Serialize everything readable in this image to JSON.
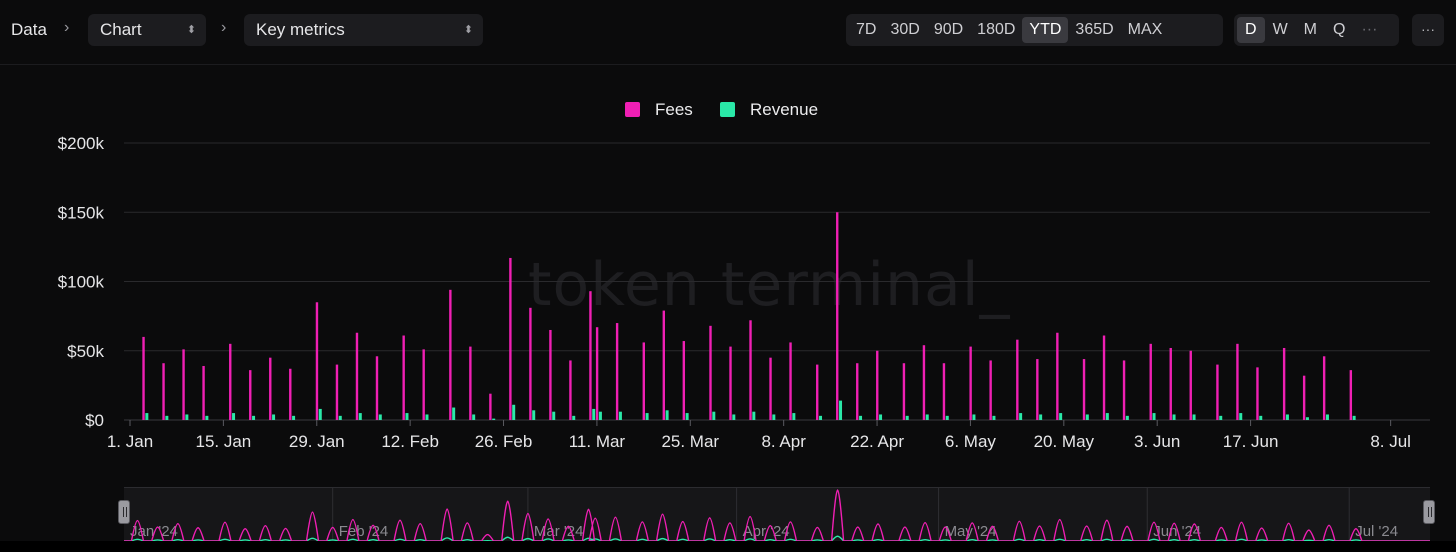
{
  "breadcrumb": {
    "root": "Data",
    "select1": "Chart",
    "select2": "Key metrics"
  },
  "ranges": [
    "7D",
    "30D",
    "90D",
    "180D",
    "YTD",
    "365D",
    "MAX"
  ],
  "active_range": "YTD",
  "granularity": [
    "D",
    "W",
    "M",
    "Q",
    "···"
  ],
  "active_granularity": "D",
  "more": "···",
  "watermark": "token terminal_",
  "colors": {
    "fees": "#f01fb4",
    "revenue": "#2ae8a8",
    "grid": "#2a2a2d",
    "background": "#0b0b0c"
  },
  "chart_data": {
    "type": "bar",
    "title": "",
    "legend_position": "top-center",
    "grid": true,
    "ylim": [
      0,
      200000
    ],
    "y_ticks": [
      0,
      50000,
      100000,
      150000,
      200000
    ],
    "y_tick_labels": [
      "$0",
      "$50k",
      "$100k",
      "$150k",
      "$200k"
    ],
    "x_tick_labels": [
      "1. Jan",
      "15. Jan",
      "29. Jan",
      "12. Feb",
      "26. Feb",
      "11. Mar",
      "25. Mar",
      "8. Apr",
      "22. Apr",
      "6. May",
      "20. May",
      "3. Jun",
      "17. Jun",
      "8. Jul"
    ],
    "x_tick_dates": [
      "2024-01-01",
      "2024-01-15",
      "2024-01-29",
      "2024-02-12",
      "2024-02-26",
      "2024-03-11",
      "2024-03-25",
      "2024-04-08",
      "2024-04-22",
      "2024-05-06",
      "2024-05-20",
      "2024-06-03",
      "2024-06-17",
      "2024-07-08"
    ],
    "x_range": [
      "2024-01-01",
      "2024-07-13"
    ],
    "dates": [
      "2024-01-03",
      "2024-01-06",
      "2024-01-09",
      "2024-01-12",
      "2024-01-16",
      "2024-01-19",
      "2024-01-22",
      "2024-01-25",
      "2024-01-29",
      "2024-02-01",
      "2024-02-04",
      "2024-02-07",
      "2024-02-11",
      "2024-02-14",
      "2024-02-18",
      "2024-02-21",
      "2024-02-24",
      "2024-02-27",
      "2024-03-01",
      "2024-03-04",
      "2024-03-07",
      "2024-03-10",
      "2024-03-11",
      "2024-03-14",
      "2024-03-18",
      "2024-03-21",
      "2024-03-24",
      "2024-03-28",
      "2024-03-31",
      "2024-04-03",
      "2024-04-06",
      "2024-04-09",
      "2024-04-13",
      "2024-04-16",
      "2024-04-19",
      "2024-04-22",
      "2024-04-26",
      "2024-04-29",
      "2024-05-02",
      "2024-05-06",
      "2024-05-09",
      "2024-05-13",
      "2024-05-16",
      "2024-05-19",
      "2024-05-23",
      "2024-05-26",
      "2024-05-29",
      "2024-06-02",
      "2024-06-05",
      "2024-06-08",
      "2024-06-12",
      "2024-06-15",
      "2024-06-18",
      "2024-06-22",
      "2024-06-25",
      "2024-06-28",
      "2024-07-02",
      "2024-07-05",
      "2024-07-08",
      "2024-07-11"
    ],
    "series": [
      {
        "name": "Fees",
        "color": "#f01fb4",
        "values": [
          60000,
          41000,
          51000,
          39000,
          55000,
          36000,
          45000,
          37000,
          85000,
          40000,
          63000,
          46000,
          61000,
          51000,
          94000,
          53000,
          19000,
          117000,
          81000,
          65000,
          43000,
          93000,
          67000,
          70000,
          56000,
          79000,
          57000,
          68000,
          53000,
          72000,
          45000,
          56000,
          40000,
          150000,
          41000,
          50000,
          41000,
          54000,
          41000,
          53000,
          43000,
          58000,
          44000,
          63000,
          44000,
          61000,
          43000,
          55000,
          52000,
          50000,
          40000,
          55000,
          38000,
          52000,
          32000,
          46000,
          36000,
          0,
          0,
          0
        ]
      },
      {
        "name": "Revenue",
        "color": "#2ae8a8",
        "values": [
          5000,
          3000,
          4000,
          3000,
          5000,
          3000,
          4000,
          3000,
          8000,
          3000,
          5000,
          4000,
          5000,
          4000,
          9000,
          4000,
          1000,
          11000,
          7000,
          6000,
          3000,
          8000,
          6000,
          6000,
          5000,
          7000,
          5000,
          6000,
          4000,
          6000,
          4000,
          5000,
          3000,
          14000,
          3000,
          4000,
          3000,
          4000,
          3000,
          4000,
          3000,
          5000,
          4000,
          5000,
          4000,
          5000,
          3000,
          5000,
          4000,
          4000,
          3000,
          5000,
          3000,
          4000,
          2000,
          4000,
          3000,
          0,
          0,
          0
        ]
      }
    ],
    "navigator_labels": [
      "Jan '24",
      "Feb '24",
      "Mar '24",
      "Apr '24",
      "May '24",
      "Jun '24",
      "Jul '24"
    ]
  }
}
